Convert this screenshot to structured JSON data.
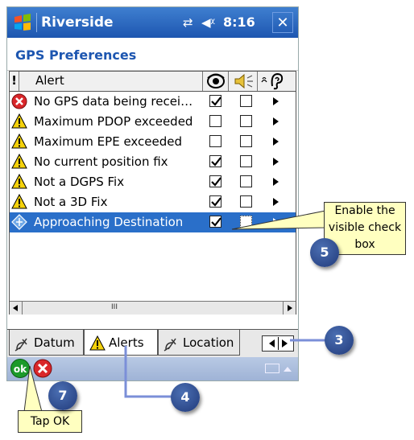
{
  "window": {
    "title": "Riverside",
    "time": "8:16",
    "close_label": "✕"
  },
  "page_title": "GPS Preferences",
  "list": {
    "header": {
      "alert_label": "Alert",
      "col1_icon": "eye-icon",
      "col2_icon": "speaker-icon",
      "col3_icon": "ear-icon"
    },
    "rows": [
      {
        "label": "No GPS data being recei…",
        "icon": "error-icon",
        "visible": true,
        "audible": false,
        "selected": false
      },
      {
        "label": "Maximum PDOP exceeded",
        "icon": "warning-icon",
        "visible": false,
        "audible": false,
        "selected": false
      },
      {
        "label": "Maximum EPE exceeded",
        "icon": "warning-icon",
        "visible": false,
        "audible": false,
        "selected": false
      },
      {
        "label": "No current position fix",
        "icon": "warning-icon",
        "visible": true,
        "audible": false,
        "selected": false
      },
      {
        "label": "Not a DGPS Fix",
        "icon": "warning-icon",
        "visible": true,
        "audible": false,
        "selected": false
      },
      {
        "label": "Not a 3D Fix",
        "icon": "warning-icon",
        "visible": true,
        "audible": false,
        "selected": false
      },
      {
        "label": "Approaching Destination",
        "icon": "info-icon",
        "visible": true,
        "audible": false,
        "selected": true
      }
    ],
    "scroll_thumb": "III"
  },
  "tabs": [
    {
      "label": "Datum",
      "icon": "satellite-icon",
      "active": false
    },
    {
      "label": "Alerts",
      "icon": "warning-icon",
      "active": true
    },
    {
      "label": "Location",
      "icon": "satellite-icon",
      "active": false
    }
  ],
  "bottom": {
    "ok_label": "ok"
  },
  "callouts": {
    "enable_visible": "Enable the visible check box",
    "tap_ok": "Tap OK"
  },
  "badges": {
    "b3": "3",
    "b4": "4",
    "b5": "5",
    "b7": "7"
  },
  "colors": {
    "title_bar": "#1d56b0",
    "selection": "#2a6fc9",
    "callout_bg": "#ffffc0",
    "badge": "#2e4e93",
    "connector": "#7b8fd8"
  }
}
